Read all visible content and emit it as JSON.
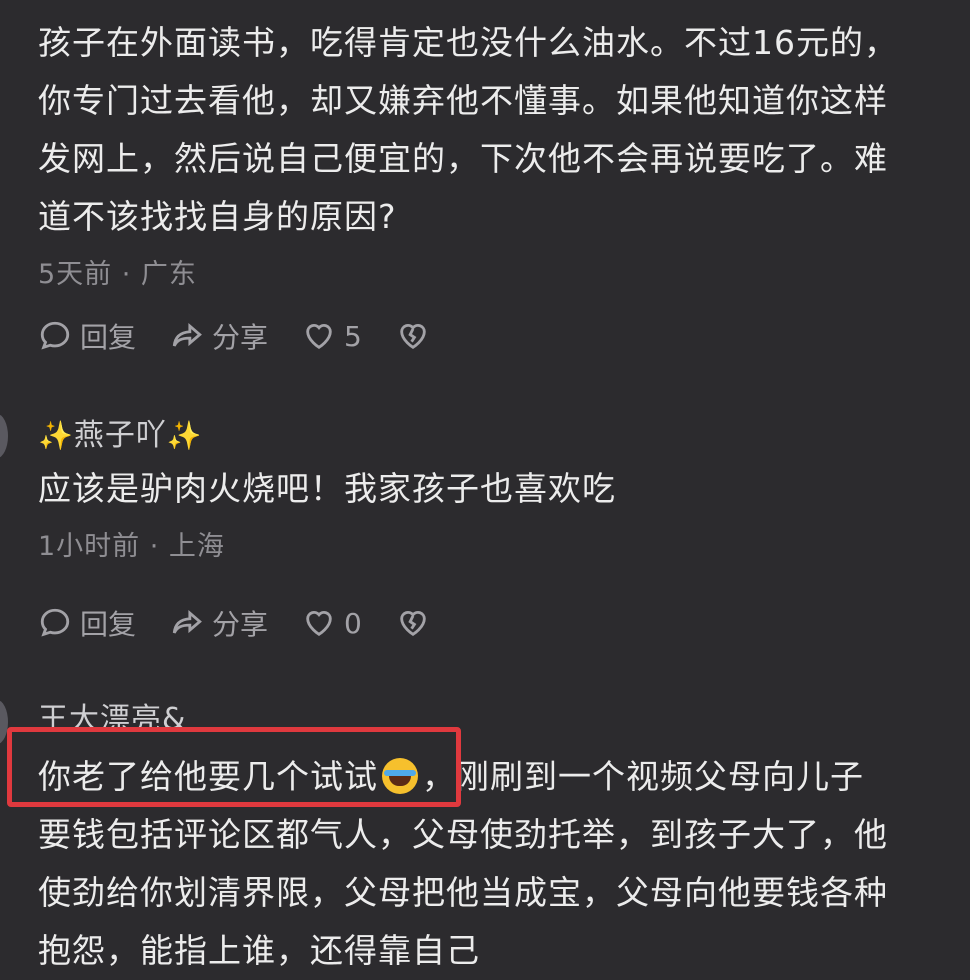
{
  "comments": [
    {
      "username": "",
      "lines": [
        "孩子在外面读书，吃得肯定也没什么油水。不过16元的，",
        "你专门过去看他，却又嫌弃他不懂事。如果他知道你这样",
        "发网上，然后说自己便宜的，下次他不会再说要吃了。难",
        "道不该找找自身的原因?"
      ],
      "meta": "5天前 · 广东",
      "reply_label": "回复",
      "share_label": "分享",
      "like_count": "5"
    },
    {
      "username": "燕子吖",
      "username_prefix": "✨",
      "username_suffix": "✨",
      "lines": [
        "应该是驴肉火烧吧！我家孩子也喜欢吃"
      ],
      "meta": "1小时前 · 上海",
      "reply_label": "回复",
      "share_label": "分享",
      "like_count": "0"
    },
    {
      "username": "王大漂亮&",
      "line1_highlighted": "你老了给他要几个试试",
      "line1_rest": "，刚刷到一个视频父母向儿子",
      "lines": [
        "要钱包括评论区都气人，父母使劲托举，到孩子大了，他",
        "使劲给你划清界限，父母把他当成宝，父母向他要钱各种",
        "抱怨，能指上谁，还得靠自己"
      ]
    }
  ],
  "icons": {
    "reply": "comment-bubble-icon",
    "share": "share-arrow-icon",
    "like": "heart-icon",
    "dislike": "broken-heart-icon",
    "emoji": "rolling-laughing-emoji"
  },
  "colors": {
    "background": "#2c2b2e",
    "highlight": "#e0393e"
  }
}
